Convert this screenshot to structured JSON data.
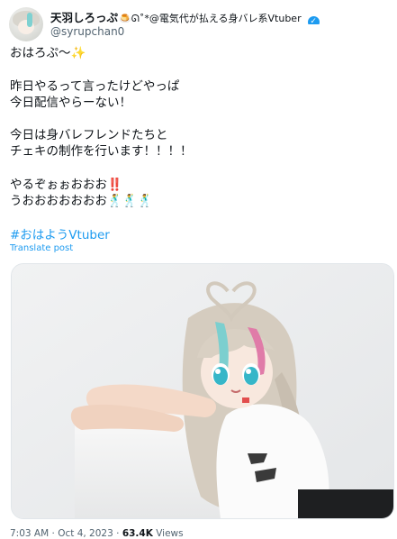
{
  "author": {
    "name": "天羽しろっぷ",
    "name_suffix": "🍮ᘏ˚*@電気代が払える身バレ系Vtuber",
    "handle": "@syrupchan0"
  },
  "tweet": {
    "lines1": [
      "おはろぷ〜✨"
    ],
    "lines2": [
      "昨日やるって言ったけどやっぱ",
      "今日配信やらーない！"
    ],
    "lines3": [
      "今日は身バレフレンドたちと",
      "チェキの制作を行います！！！！"
    ],
    "lines4": [
      "やるぞぉぉおおお‼️",
      "うおおおおおおお🕺🕺🕺"
    ],
    "hashtag": "#おはようVtuber",
    "translate": "Translate post"
  },
  "meta": {
    "time": "7:03 AM",
    "sep1": "·",
    "date": "Oct 4, 2023",
    "sep2": "·",
    "views_count": "63.4K",
    "views_label": "Views"
  },
  "icons": {
    "verified": "verified-badge-icon"
  },
  "colors": {
    "accent": "#1d9bf0",
    "text": "#0f1419",
    "muted": "#536471"
  }
}
